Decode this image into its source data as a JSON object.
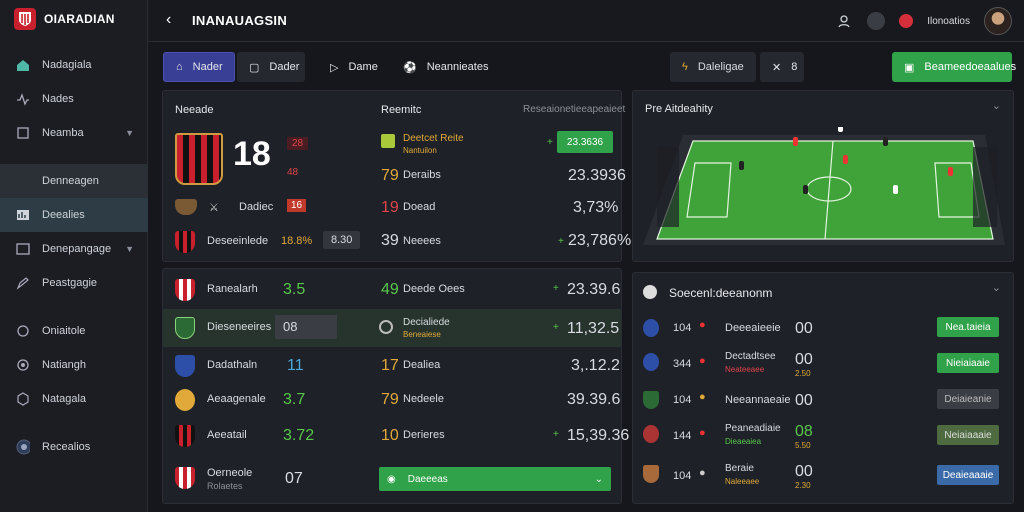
{
  "app": {
    "title": "OIARADIAN"
  },
  "sidebar": {
    "items": [
      {
        "label": "Nadagiala",
        "icon": "home-icon"
      },
      {
        "label": "Nades",
        "icon": "pulse-icon"
      },
      {
        "label": "Neamba",
        "icon": "box-icon",
        "chevron": "chevron-down-icon"
      },
      {
        "label": "Denneagen",
        "icon": "folder-icon"
      },
      {
        "label": "Deealies",
        "icon": "chart-icon"
      },
      {
        "label": "Denepangage",
        "icon": "window-icon",
        "chevron": "chevron-down-icon"
      },
      {
        "label": "Peastgagie",
        "icon": "pencil-icon"
      },
      {
        "label": "Oniaitole",
        "icon": "chat-icon"
      },
      {
        "label": "Natiangh",
        "icon": "target-icon"
      },
      {
        "label": "Natagala",
        "icon": "cube-icon"
      },
      {
        "label": "Recealios",
        "icon": "settings-icon"
      }
    ]
  },
  "header": {
    "title": "INANAUAGSIN",
    "user_name": "Ilonoatios"
  },
  "toolbar": {
    "b1": "Nader",
    "b2": "Dader",
    "b3": "Dame",
    "b4": "Neannieates",
    "b5": "Daleligae",
    "b6": "8",
    "b7": "Beameedoeaalues"
  },
  "top_panel": {
    "col1": "Neeade",
    "col2": "Reemitc",
    "col3": "Reseaionetieeapeaieet",
    "main_team": {
      "score": "18",
      "badge": "28",
      "sub": "48"
    },
    "row1": {
      "left_label": "Deetcet Reite",
      "left_sub": "Nantuilon",
      "value": "23.3636"
    },
    "row2": {
      "num": "79",
      "label": "Deraibs",
      "value": "23.3936"
    },
    "row3": {
      "team": "Dadiec",
      "badge": "16",
      "num": "19",
      "label": "Doead",
      "value": "3,73%"
    },
    "row4": {
      "team": "Deseeinlede",
      "pct": "18.8%",
      "badge": "8.30",
      "num": "39",
      "label": "Neeees",
      "value": "23,786%"
    }
  },
  "mid_panel": {
    "rows": [
      {
        "team": "Ranealarh",
        "val": "3.5",
        "num": "49",
        "label": "Deede Oees",
        "value": "23.39.6"
      },
      {
        "team": "Dieseneeires",
        "val": "08",
        "num": "",
        "label": "Decialiede",
        "sub": "Beneaiese",
        "value": "11,32.5"
      },
      {
        "team": "Dadathaln",
        "val": "11",
        "num": "17",
        "label": "Dealiea",
        "value": "3,.12.2"
      },
      {
        "team": "Aeaagenale",
        "val": "3.7",
        "num": "79",
        "label": "Nedeele",
        "value": "39.39.6"
      },
      {
        "team": "Aeeatail",
        "val": "3.72",
        "num": "10",
        "label": "Derieres",
        "value": "15,39.36"
      },
      {
        "team": "Oerneole",
        "sub": "Rolaetes",
        "val": "07",
        "button": "Daeeeas"
      }
    ]
  },
  "field_panel": {
    "title": "Pre Aitdeahity"
  },
  "side_panel": {
    "title": "Soecenl:deeanonm",
    "rows": [
      {
        "num": "104",
        "name": "Deeeaieeie",
        "sub": "",
        "score": "00",
        "btn": "Nea.taieia"
      },
      {
        "num": "344",
        "name": "Dectadtsee",
        "sub": "Neateeaee",
        "score": "00",
        "sub2": "2.50",
        "btn": "Nieiaiaaie"
      },
      {
        "num": "104",
        "name": "Neeannaeaie",
        "sub": "",
        "score": "00",
        "btn": "Deiaieanie"
      },
      {
        "num": "144",
        "name": "Peaneadiaie",
        "sub": "Dieaeaiea",
        "score": "08",
        "sub2": "5.50",
        "btn": "Neiaiaaaie"
      },
      {
        "num": "104",
        "name": "Beraie",
        "sub": "Naleeaee",
        "score": "00",
        "sub2": "2.30",
        "btn": "Deaieaaaie"
      }
    ]
  },
  "colors": {
    "accent_green": "#2fa24a",
    "accent_blue": "#3a3f96",
    "brand_red": "#c8202c"
  }
}
